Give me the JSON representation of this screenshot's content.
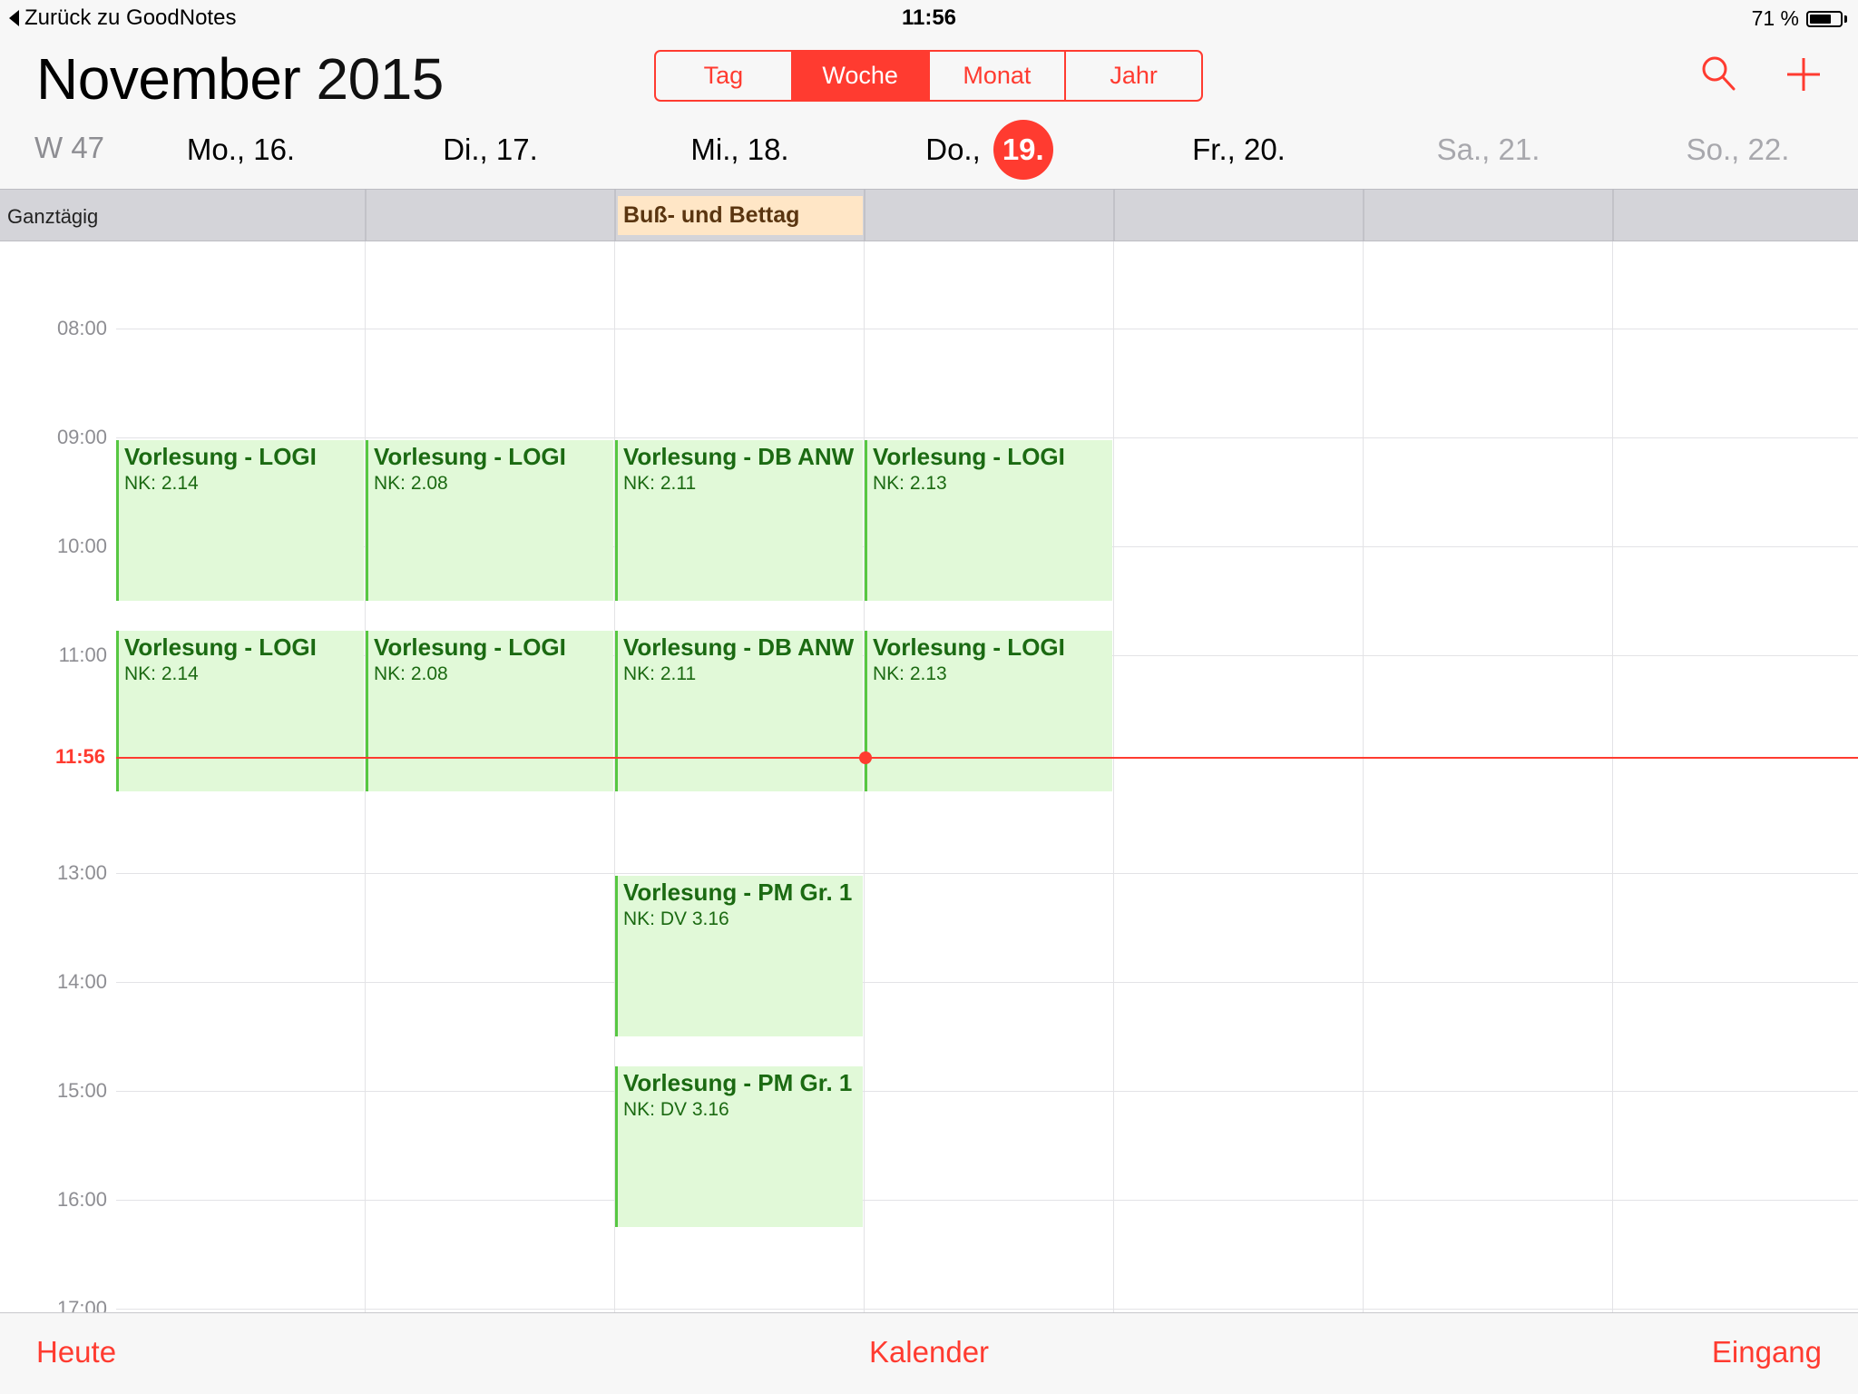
{
  "status": {
    "back_label": "Zurück zu GoodNotes",
    "time": "11:56",
    "battery": "71 %",
    "battery_level": 0.71
  },
  "header": {
    "month": "November",
    "year": "2015",
    "segments": [
      "Tag",
      "Woche",
      "Monat",
      "Jahr"
    ],
    "active_segment": "Woche",
    "week_label": "W 47",
    "days": [
      {
        "label": "Mo., 16.",
        "weekend": false
      },
      {
        "label": "Di., 17.",
        "weekend": false
      },
      {
        "label": "Mi., 18.",
        "weekend": false
      },
      {
        "label": "Do.,",
        "today_number": "19.",
        "weekend": false
      },
      {
        "label": "Fr., 20.",
        "weekend": false
      },
      {
        "label": "Sa., 21.",
        "weekend": true
      },
      {
        "label": "So., 22.",
        "weekend": true
      }
    ]
  },
  "allday": {
    "label": "Ganztägig",
    "event": {
      "title": "Buß- und Bettag",
      "day": 2
    }
  },
  "grid": {
    "hour_labels": [
      "08:00",
      "09:00",
      "10:00",
      "11:00",
      "13:00",
      "14:00",
      "15:00",
      "16:00",
      "17:00"
    ],
    "now_label": "11:56",
    "events": [
      {
        "day": 0,
        "start": "09:00",
        "end": "10:30",
        "title": "Vorlesung - LOGI",
        "location": "NK: 2.14"
      },
      {
        "day": 1,
        "start": "09:00",
        "end": "10:30",
        "title": "Vorlesung - LOGI",
        "location": "NK: 2.08"
      },
      {
        "day": 2,
        "start": "09:00",
        "end": "10:30",
        "title": "Vorlesung - DB ANW",
        "location": "NK: 2.11"
      },
      {
        "day": 3,
        "start": "09:00",
        "end": "10:30",
        "title": "Vorlesung - LOGI",
        "location": "NK: 2.13"
      },
      {
        "day": 0,
        "start": "10:45",
        "end": "12:15",
        "title": "Vorlesung - LOGI",
        "location": "NK: 2.14"
      },
      {
        "day": 1,
        "start": "10:45",
        "end": "12:15",
        "title": "Vorlesung - LOGI",
        "location": "NK: 2.08"
      },
      {
        "day": 2,
        "start": "10:45",
        "end": "12:15",
        "title": "Vorlesung - DB ANW",
        "location": "NK: 2.11"
      },
      {
        "day": 3,
        "start": "10:45",
        "end": "12:15",
        "title": "Vorlesung - LOGI",
        "location": "NK: 2.13"
      },
      {
        "day": 2,
        "start": "13:00",
        "end": "14:30",
        "title": "Vorlesung - PM Gr. 1",
        "location": "NK: DV 3.16"
      },
      {
        "day": 2,
        "start": "14:45",
        "end": "16:15",
        "title": "Vorlesung - PM Gr. 1",
        "location": "NK: DV 3.16"
      }
    ]
  },
  "tabbar": {
    "left": "Heute",
    "center": "Kalender",
    "right": "Eingang"
  },
  "colors": {
    "accent": "#ff3b30",
    "event_bg": "#e1f9d8",
    "event_bar": "#57c742",
    "event_text": "#1b6a12",
    "holiday_bg": "#ffe6c6"
  }
}
